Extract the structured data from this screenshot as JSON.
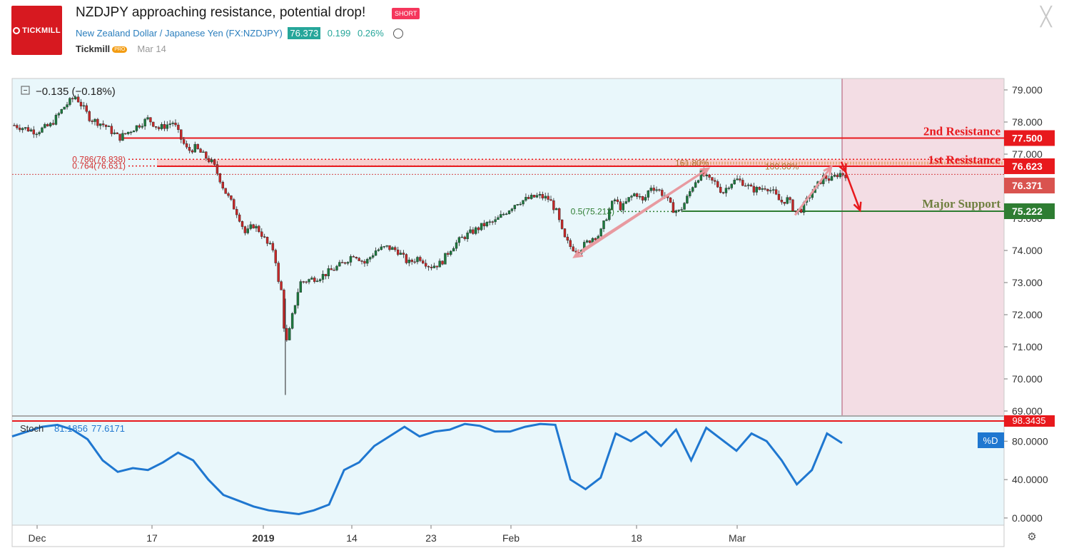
{
  "header": {
    "logo_text": "TICKMILL",
    "title": "NZDJPY approaching resistance, potential drop!",
    "badge": "SHORT",
    "instrument": "New Zealand Dollar / Japanese Yen",
    "symbol": "(FX:NZDJPY)",
    "price": "76.373",
    "change": "0.199",
    "change_pct": "0.26%",
    "author": "Tickmill",
    "author_badge": "PRO",
    "date": "Mar 14",
    "close_glyph": "╳"
  },
  "colors": {
    "up": "#26a69a",
    "down": "#d32f2f",
    "candle_up": "#1b7a3e",
    "resistance": "#e8191d",
    "support": "#2e7d32",
    "stoch": "#1f77d0",
    "bg": "#e9f7fb",
    "shade": "#f3dde4"
  },
  "chart_data": {
    "type": "candlestick",
    "symbol": "NZDJPY",
    "legend": "−0.135 (−0.18%)",
    "y_ticks": [
      "79.000",
      "78.000",
      "77.000",
      "76.000",
      "75.000",
      "74.000",
      "73.000",
      "72.000",
      "71.000",
      "70.000",
      "69.000"
    ],
    "ylim": [
      69,
      79.2
    ],
    "x_ticks": [
      "Dec",
      "17",
      "2019",
      "14",
      "23",
      "Feb",
      "18",
      "Mar"
    ],
    "price_labels": {
      "r2": "77.500",
      "r1": "76.623",
      "last": "76.371",
      "support": "75.222"
    },
    "levels": [
      {
        "name": "2nd Resistance",
        "value": 77.5
      },
      {
        "name": "1st Resistance",
        "value": 76.623
      },
      {
        "name": "Major Support",
        "value": 75.222
      }
    ],
    "fib": [
      {
        "label": "0.786(76.838)",
        "value": 76.838
      },
      {
        "label": "0.764(76.631)",
        "value": 76.631
      },
      {
        "label": "0.5(75.213)",
        "value": 75.213
      },
      {
        "label": "161.80%",
        "value": 76.72
      },
      {
        "label": "100.00%",
        "value": 76.7
      }
    ],
    "close_path": [
      [
        0,
        77.9
      ],
      [
        6,
        77.7
      ],
      [
        10,
        77.9
      ],
      [
        14,
        78.5
      ],
      [
        17,
        78.8
      ],
      [
        21,
        78.1
      ],
      [
        25,
        77.9
      ],
      [
        29,
        77.5
      ],
      [
        33,
        77.8
      ],
      [
        37,
        78.1
      ],
      [
        40,
        77.8
      ],
      [
        44,
        78
      ],
      [
        46,
        77.5
      ],
      [
        48,
        77.1
      ],
      [
        50,
        77.2
      ],
      [
        52,
        77
      ],
      [
        55,
        76.7
      ],
      [
        57,
        76.2
      ],
      [
        58,
        75.9
      ],
      [
        60,
        75.5
      ],
      [
        62,
        75.1
      ],
      [
        64,
        74.5
      ],
      [
        66,
        74.8
      ],
      [
        68,
        74.6
      ],
      [
        70,
        74.2
      ],
      [
        72,
        74
      ],
      [
        73,
        73
      ],
      [
        74,
        72.7
      ],
      [
        75,
        71
      ],
      [
        76,
        71.4
      ],
      [
        77,
        72
      ],
      [
        79,
        73
      ],
      [
        82,
        73.1
      ],
      [
        85,
        73.2
      ],
      [
        88,
        73.4
      ],
      [
        91,
        73.6
      ],
      [
        94,
        73.9
      ],
      [
        97,
        73.6
      ],
      [
        100,
        74
      ],
      [
        103,
        74.1
      ],
      [
        106,
        74
      ],
      [
        109,
        73.6
      ],
      [
        112,
        73.8
      ],
      [
        115,
        73.5
      ],
      [
        118,
        73.6
      ],
      [
        121,
        74.1
      ],
      [
        124,
        74.4
      ],
      [
        127,
        74.6
      ],
      [
        130,
        74.8
      ],
      [
        133,
        74.9
      ],
      [
        136,
        75.2
      ],
      [
        139,
        75.5
      ],
      [
        142,
        75.6
      ],
      [
        145,
        75.7
      ],
      [
        148,
        75.6
      ],
      [
        150,
        75.2
      ],
      [
        152,
        74.4
      ],
      [
        154,
        74.1
      ],
      [
        156,
        74
      ],
      [
        158,
        74.2
      ],
      [
        160,
        74.4
      ],
      [
        162,
        74.5
      ],
      [
        164,
        75.1
      ],
      [
        166,
        75.6
      ],
      [
        168,
        75.3
      ],
      [
        170,
        75.6
      ],
      [
        172,
        75.8
      ],
      [
        174,
        75.5
      ],
      [
        176,
        76
      ],
      [
        178,
        75.9
      ],
      [
        180,
        75.7
      ],
      [
        182,
        75.3
      ],
      [
        184,
        75.2
      ],
      [
        186,
        75.6
      ],
      [
        188,
        76.1
      ],
      [
        190,
        76.4
      ],
      [
        192,
        76.2
      ],
      [
        194,
        76.1
      ],
      [
        196,
        75.8
      ],
      [
        198,
        76.1
      ],
      [
        200,
        76.2
      ],
      [
        202,
        76.1
      ],
      [
        204,
        75.9
      ],
      [
        206,
        75.9
      ],
      [
        208,
        76
      ],
      [
        210,
        75.8
      ],
      [
        212,
        75.5
      ],
      [
        214,
        75.6
      ],
      [
        216,
        75.2
      ],
      [
        218,
        75.3
      ],
      [
        220,
        75.7
      ],
      [
        222,
        76
      ],
      [
        224,
        76.3
      ],
      [
        226,
        76.2
      ],
      [
        228,
        76.4
      ],
      [
        230,
        76.37
      ]
    ],
    "marked_points": {
      "low": 70.5,
      "low_wick": 69.5,
      "high": 78.8
    },
    "x_range": [
      0,
      230
    ],
    "projection": [
      [
        230,
        76.45
      ],
      [
        233,
        75.25
      ]
    ],
    "indicator": {
      "name": "Stoch",
      "values": [
        "81.1856",
        "77.6171"
      ],
      "y_ticks": [
        "80.0000",
        "40.0000",
        "0.0000"
      ],
      "ylim": [
        -6,
        104
      ],
      "label_top": "98.3435",
      "label_d": "%D",
      "series": [
        85,
        90,
        95,
        97,
        92,
        82,
        60,
        48,
        52,
        50,
        58,
        68,
        60,
        40,
        24,
        18,
        12,
        8,
        6,
        4,
        8,
        14,
        50,
        58,
        75,
        85,
        95,
        85,
        90,
        92,
        98,
        96,
        90,
        90,
        95,
        98,
        97,
        40,
        30,
        42,
        88,
        80,
        90,
        75,
        92,
        60,
        94,
        82,
        70,
        88,
        80,
        60,
        35,
        50,
        88,
        78
      ]
    }
  }
}
